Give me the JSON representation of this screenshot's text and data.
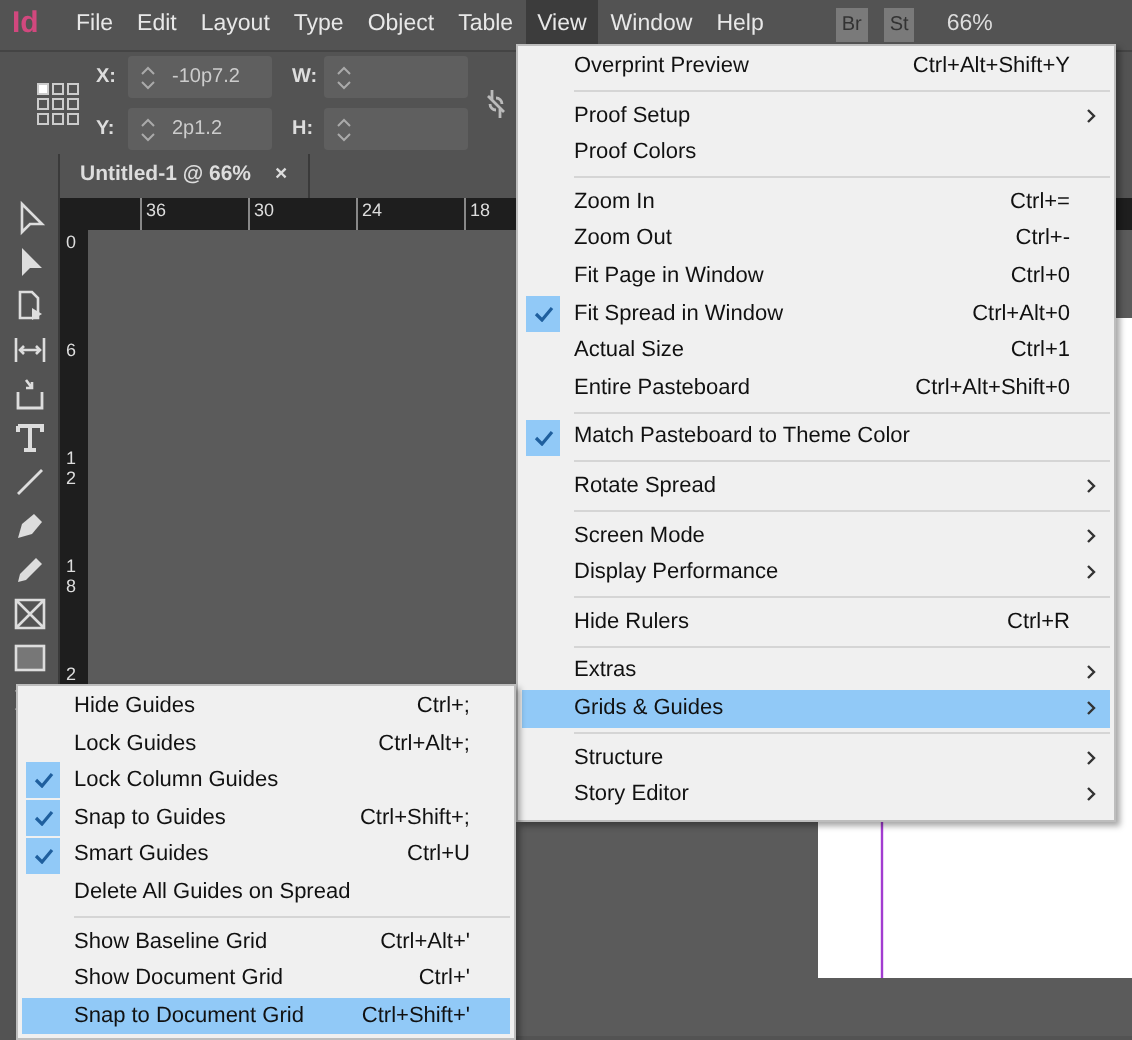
{
  "app": {
    "logo": "Id",
    "menus": [
      {
        "label": "File",
        "selected": false
      },
      {
        "label": "Edit",
        "selected": false
      },
      {
        "label": "Layout",
        "selected": false
      },
      {
        "label": "Type",
        "selected": false
      },
      {
        "label": "Object",
        "selected": false
      },
      {
        "label": "Table",
        "selected": false
      },
      {
        "label": "View",
        "selected": true
      },
      {
        "label": "Window",
        "selected": false
      },
      {
        "label": "Help",
        "selected": false
      }
    ],
    "bridge": "Br",
    "stock": "St",
    "zoom": "66%"
  },
  "control_panel": {
    "fields": [
      {
        "label": "X:",
        "value": "-10p7.2"
      },
      {
        "label": "Y:",
        "value": "2p1.2"
      },
      {
        "label": "W:"
      },
      {
        "label": "H:"
      }
    ]
  },
  "document_tab": {
    "title": "Untitled-1 @ 66%",
    "close": "×"
  },
  "rulers": {
    "horizontal": [
      "36",
      "30",
      "24",
      "18"
    ],
    "vertical": [
      "0",
      "6",
      "12",
      "18",
      "2"
    ]
  },
  "view_menu": {
    "items": [
      {
        "kind": "item",
        "label": "Overprint Preview",
        "shortcut": "Ctrl+Alt+Shift+Y",
        "checked": false,
        "submenu": false,
        "selected": false
      },
      {
        "kind": "separator"
      },
      {
        "kind": "item",
        "label": "Proof Setup",
        "checked": false,
        "submenu": true,
        "selected": false
      },
      {
        "kind": "item",
        "label": "Proof Colors",
        "checked": false,
        "submenu": false,
        "selected": false
      },
      {
        "kind": "separator"
      },
      {
        "kind": "item",
        "label": "Zoom In",
        "shortcut": "Ctrl+=",
        "checked": false,
        "submenu": false,
        "selected": false
      },
      {
        "kind": "item",
        "label": "Zoom Out",
        "shortcut": "Ctrl+-",
        "checked": false,
        "submenu": false,
        "selected": false
      },
      {
        "kind": "item",
        "label": "Fit Page in Window",
        "shortcut": "Ctrl+0",
        "checked": false,
        "submenu": false,
        "selected": false
      },
      {
        "kind": "item",
        "label": "Fit Spread in Window",
        "shortcut": "Ctrl+Alt+0",
        "checked": true,
        "submenu": false,
        "selected": false
      },
      {
        "kind": "item",
        "label": "Actual Size",
        "shortcut": "Ctrl+1",
        "checked": false,
        "submenu": false,
        "selected": false
      },
      {
        "kind": "item",
        "label": "Entire Pasteboard",
        "shortcut": "Ctrl+Alt+Shift+0",
        "checked": false,
        "submenu": false,
        "selected": false
      },
      {
        "kind": "separator"
      },
      {
        "kind": "item",
        "label": "Match Pasteboard to Theme Color",
        "checked": true,
        "submenu": false,
        "selected": false
      },
      {
        "kind": "separator"
      },
      {
        "kind": "item",
        "label": "Rotate Spread",
        "checked": false,
        "submenu": true,
        "selected": false
      },
      {
        "kind": "separator"
      },
      {
        "kind": "item",
        "label": "Screen Mode",
        "checked": false,
        "submenu": true,
        "selected": false
      },
      {
        "kind": "item",
        "label": "Display Performance",
        "checked": false,
        "submenu": true,
        "selected": false
      },
      {
        "kind": "separator"
      },
      {
        "kind": "item",
        "label": "Hide Rulers",
        "shortcut": "Ctrl+R",
        "checked": false,
        "submenu": false,
        "selected": false
      },
      {
        "kind": "separator"
      },
      {
        "kind": "item",
        "label": "Extras",
        "checked": false,
        "submenu": true,
        "selected": false
      },
      {
        "kind": "item",
        "label": "Grids & Guides",
        "checked": false,
        "submenu": true,
        "selected": true
      },
      {
        "kind": "separator"
      },
      {
        "kind": "item",
        "label": "Structure",
        "checked": false,
        "submenu": true,
        "selected": false
      },
      {
        "kind": "item",
        "label": "Story Editor",
        "checked": false,
        "submenu": true,
        "selected": false
      }
    ]
  },
  "grids_submenu": {
    "items": [
      {
        "kind": "item",
        "label": "Hide Guides",
        "shortcut": "Ctrl+;",
        "checked": false,
        "submenu": false,
        "selected": false
      },
      {
        "kind": "item",
        "label": "Lock Guides",
        "shortcut": "Ctrl+Alt+;",
        "checked": false,
        "submenu": false,
        "selected": false
      },
      {
        "kind": "item",
        "label": "Lock Column Guides",
        "checked": true,
        "submenu": false,
        "selected": false
      },
      {
        "kind": "item",
        "label": "Snap to Guides",
        "shortcut": "Ctrl+Shift+;",
        "checked": true,
        "submenu": false,
        "selected": false
      },
      {
        "kind": "item",
        "label": "Smart Guides",
        "shortcut": "Ctrl+U",
        "checked": true,
        "submenu": false,
        "selected": false
      },
      {
        "kind": "item",
        "label": "Delete All Guides on Spread",
        "checked": false,
        "submenu": false,
        "selected": false
      },
      {
        "kind": "separator"
      },
      {
        "kind": "item",
        "label": "Show Baseline Grid",
        "shortcut": "Ctrl+Alt+'",
        "checked": false,
        "submenu": false,
        "selected": false
      },
      {
        "kind": "item",
        "label": "Show Document Grid",
        "shortcut": "Ctrl+'",
        "checked": false,
        "submenu": false,
        "selected": false
      },
      {
        "kind": "item",
        "label": "Snap to Document Grid",
        "shortcut": "Ctrl+Shift+'",
        "checked": false,
        "submenu": false,
        "selected": true
      }
    ]
  }
}
